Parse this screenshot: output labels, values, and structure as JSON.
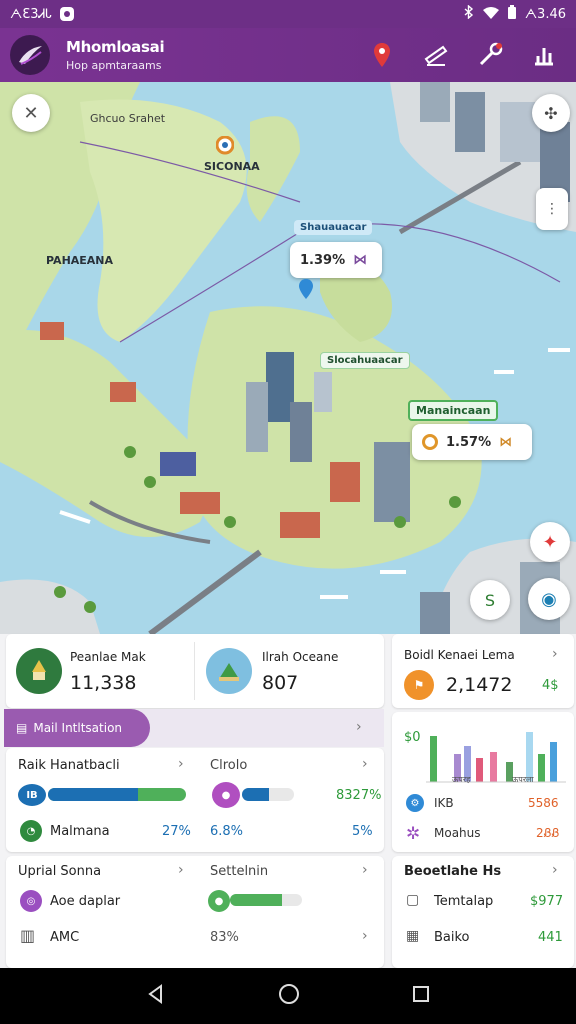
{
  "status_bar": {
    "time_left": "ᗅƐ3ᏗᏓ",
    "time_right": "ᗅ3.46",
    "icons": [
      "bluetooth-icon",
      "wifi-icon",
      "battery-icon"
    ]
  },
  "app_bar": {
    "title": "Mhomloasai",
    "subtitle": "Hop apmtaraams",
    "actions": [
      "location-pin-icon",
      "ticket-icon",
      "wrench-icon",
      "chart-icon"
    ]
  },
  "map": {
    "labels": {
      "top": "Ghcuo Srahet",
      "pin_label": "SICONAA",
      "west": "PAHAEANA",
      "tag_blue": "Shauauacar",
      "tag_green": "Slocahuaacar",
      "tag_green2": "Manaincaan"
    },
    "bubble1": {
      "value": "1.39%"
    },
    "bubble2": {
      "value": "1.57%"
    },
    "colors": {
      "water": "#a9d7e9",
      "land": "#cfe3a8"
    }
  },
  "cards": {
    "stat_left": {
      "title": "Peanlae Mak",
      "value": "11,338"
    },
    "stat_mid": {
      "title": "Ilrah Oceane",
      "value": "807"
    },
    "stat_right": {
      "title": "Boidl Kenaei Lema",
      "value": "2,1472",
      "badge": "4$"
    },
    "banner": {
      "label": "Mail Intltsation"
    },
    "chart_card": {
      "y_label": "$0",
      "x_labels": [
        "ऊपरह",
        "ऊपरला"
      ],
      "legend": [
        {
          "label": "IKB",
          "value": "5586"
        },
        {
          "label": "Moahus",
          "value": "2ᏰᏰ"
        }
      ]
    },
    "list_card_1": {
      "left_title": "Raik Hanatbacli",
      "right_title": "Clrolo",
      "row1_right_value": "8327%",
      "row2_label": "Malmana",
      "row2_value_left": "27%",
      "row2_value_mid": "6.8%",
      "row2_value_right": "5%",
      "progress": {
        "row1_left": 0.65,
        "row1_right": 0.52
      }
    },
    "list_card_2": {
      "left_title": "Uprial Sonna",
      "right_title": "Settelnin",
      "row1_label": "Aoe daplar",
      "row2_label": "AMC",
      "row2_value": "83%",
      "progress": {
        "row1_right": 0.72
      }
    },
    "list_card_3": {
      "title": "Beoetlahe Hs",
      "rows": [
        {
          "label": "Temtalap",
          "value": "$977"
        },
        {
          "label": "Baiko",
          "value": "441"
        }
      ]
    }
  }
}
